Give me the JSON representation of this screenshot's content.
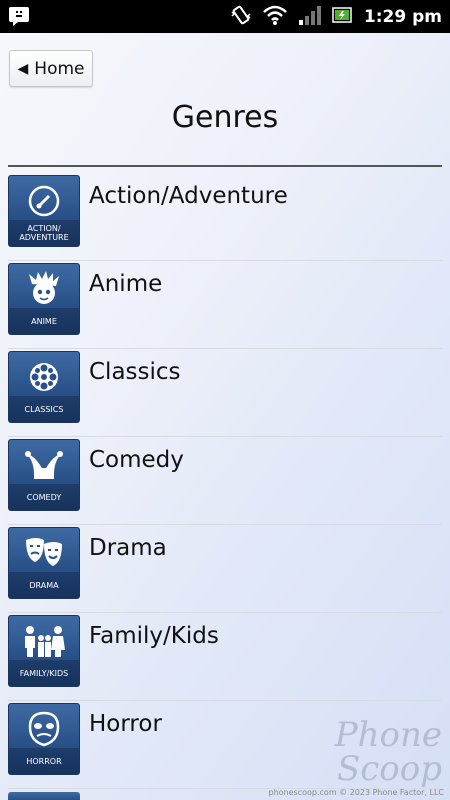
{
  "status_bar": {
    "time": "1:29 pm",
    "icons": [
      "notification-icon",
      "vibrate-icon",
      "wifi-icon",
      "signal-icon",
      "battery-icon"
    ]
  },
  "header": {
    "back_label": "Home",
    "title": "Genres"
  },
  "genres": [
    {
      "label": "Action/Adventure",
      "tile_label": "Action/ Adventure",
      "icon": "compass-icon"
    },
    {
      "label": "Anime",
      "tile_label": "Anime",
      "icon": "anime-face-icon"
    },
    {
      "label": "Classics",
      "tile_label": "Classics",
      "icon": "film-reel-icon"
    },
    {
      "label": "Comedy",
      "tile_label": "Comedy",
      "icon": "jester-hat-icon"
    },
    {
      "label": "Drama",
      "tile_label": "Drama",
      "icon": "theater-masks-icon"
    },
    {
      "label": "Family/Kids",
      "tile_label": "Family/Kids",
      "icon": "family-icon"
    },
    {
      "label": "Horror",
      "tile_label": "Horror",
      "icon": "horror-face-icon"
    }
  ],
  "watermark": {
    "line1": "Phone",
    "line2": "Scoop",
    "credit": "phonescoop.com © 2023 Phone Factor, LLC"
  },
  "colors": {
    "tile_blue": "#2a528a",
    "status_bar": "#000000"
  }
}
